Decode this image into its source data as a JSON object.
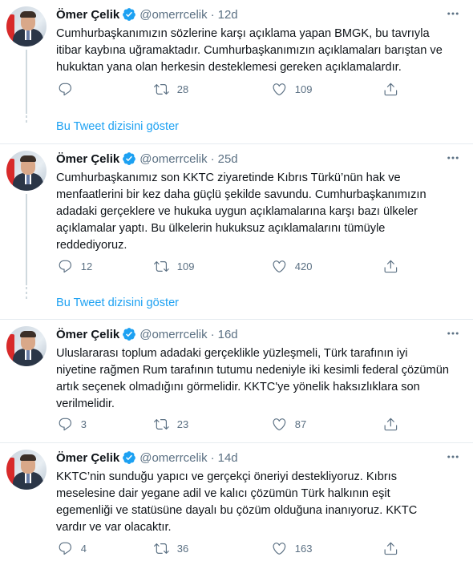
{
  "tweets": [
    {
      "author": "Ömer Çelik",
      "handle": "@omerrcelik",
      "separator": "·",
      "time": "12d",
      "text": "Cumhurbaşkanımızın sözlerine karşı açıklama yapan BMGK, bu tavrıyla itibar kaybına uğramaktadır. Cumhurbaşkanımızın açıklamaları barıştan ve hukuktan yana olan herkesin desteklemesi gereken açıklamalardır.",
      "reply_count": "",
      "retweet_count": "28",
      "like_count": "109",
      "show_thread": "Bu Tweet dizisini göster"
    },
    {
      "author": "Ömer Çelik",
      "handle": "@omerrcelik",
      "separator": "·",
      "time": "25d",
      "text": "Cumhurbaşkanımız son KKTC ziyaretinde Kıbrıs Türkü’nün hak ve menfaatlerini bir kez daha güçlü şekilde savundu. Cumhurbaşkanımızın adadaki gerçeklere ve hukuka uygun açıklamalarına karşı bazı ülkeler açıklamalar yaptı. Bu ülkelerin hukuksuz açıklamalarını tümüyle reddediyoruz.",
      "reply_count": "12",
      "retweet_count": "109",
      "like_count": "420",
      "show_thread": "Bu Tweet dizisini göster"
    },
    {
      "author": "Ömer Çelik",
      "handle": "@omerrcelik",
      "separator": "·",
      "time": "16d",
      "text": "Uluslararası toplum adadaki gerçeklikle yüzleşmeli, Türk tarafının iyi niyetine rağmen Rum tarafının tutumu nedeniyle iki kesimli federal çözümün artık seçenek olmadığını görmelidir. KKTC'ye yönelik haksızlıklara son verilmelidir.",
      "reply_count": "3",
      "retweet_count": "23",
      "like_count": "87"
    },
    {
      "author": "Ömer Çelik",
      "handle": "@omerrcelik",
      "separator": "·",
      "time": "14d",
      "text": "KKTC’nin sunduğu yapıcı ve gerçekçi öneriyi destekliyoruz. Kıbrıs meselesine dair yegane adil ve kalıcı çözümün Türk halkının eşit egemenliği ve statüsüne dayalı  bu çözüm olduğuna inanıyoruz. KKTC vardır ve var olacaktır.",
      "reply_count": "4",
      "retweet_count": "36",
      "like_count": "163"
    }
  ],
  "icons": {
    "verified": "verified-badge-icon",
    "more": "more-options-icon",
    "reply": "reply-icon",
    "retweet": "retweet-icon",
    "like": "like-heart-icon",
    "share": "share-icon"
  },
  "colors": {
    "link": "#1da1f2",
    "muted": "#5b7083",
    "verified": "#1da1f2",
    "divider": "#e6ecf0"
  }
}
